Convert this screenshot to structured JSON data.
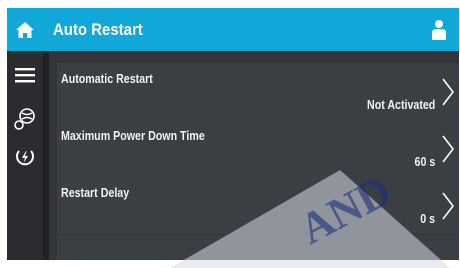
{
  "header": {
    "title": "Auto Restart",
    "home_icon": "home-icon",
    "user_icon": "user-icon",
    "accent_color": "#11a7d8"
  },
  "nav": {
    "items": [
      {
        "icon": "menu-icon"
      },
      {
        "icon": "fan-icon"
      },
      {
        "icon": "power-restart-icon"
      }
    ]
  },
  "settings": [
    {
      "label": "Automatic Restart",
      "value": "Not Activated"
    },
    {
      "label": "Maximum Power Down Time",
      "value": "60 s"
    },
    {
      "label": "Restart Delay",
      "value": "0 s"
    }
  ]
}
